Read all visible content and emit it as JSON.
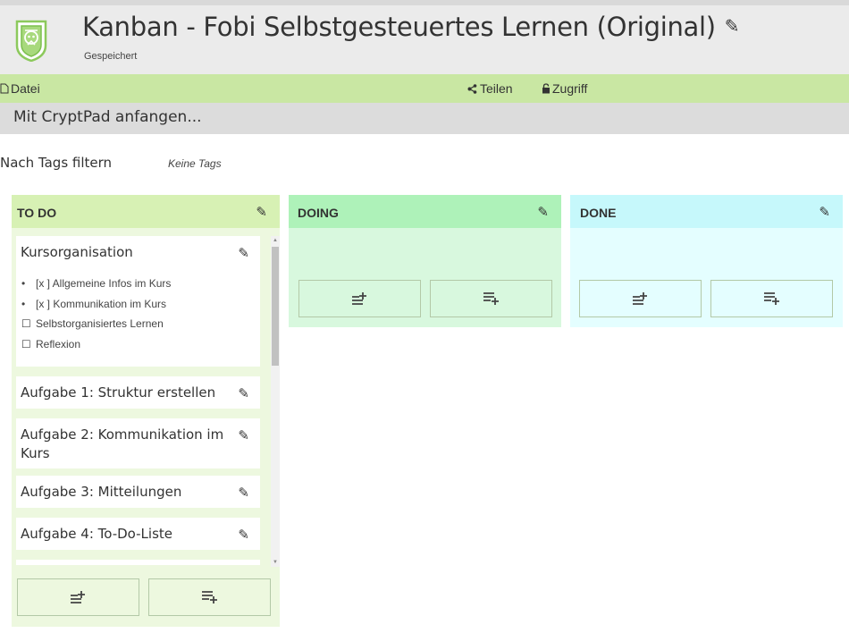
{
  "header": {
    "title": "Kanban - Fobi Selbstgesteuertes Lernen (Original)",
    "status": "Gespeichert",
    "edit_icon": "pencil-icon"
  },
  "toolbar": {
    "file_label": "Datei",
    "share_label": "Teilen",
    "access_label": "Zugriff"
  },
  "getting_started": "Mit CryptPad anfangen...",
  "tags": {
    "label": "Nach Tags filtern",
    "empty": "Keine Tags"
  },
  "columns": [
    {
      "title": "TO DO",
      "color": "#d7f1b4",
      "items": [
        {
          "title": "Kursorganisation",
          "lines": [
            {
              "marker": "•",
              "text": "[x ] Allgemeine Infos im Kurs"
            },
            {
              "marker": "•",
              "text": "[x ] Kommunikation im Kurs"
            },
            {
              "marker": "☐",
              "text": "Selbstorganisiertes Lernen"
            },
            {
              "marker": "☐",
              "text": "Reflexion"
            }
          ]
        },
        {
          "title": "Aufgabe 1: Struktur erstellen"
        },
        {
          "title": "Aufgabe 2: Kommunikation im Kurs"
        },
        {
          "title": "Aufgabe 3: Mitteilungen"
        },
        {
          "title": "Aufgabe 4: To-Do-Liste"
        }
      ]
    },
    {
      "title": "DOING",
      "color": "#aef2b9"
    },
    {
      "title": "DONE",
      "color": "#c6f8fb"
    }
  ]
}
